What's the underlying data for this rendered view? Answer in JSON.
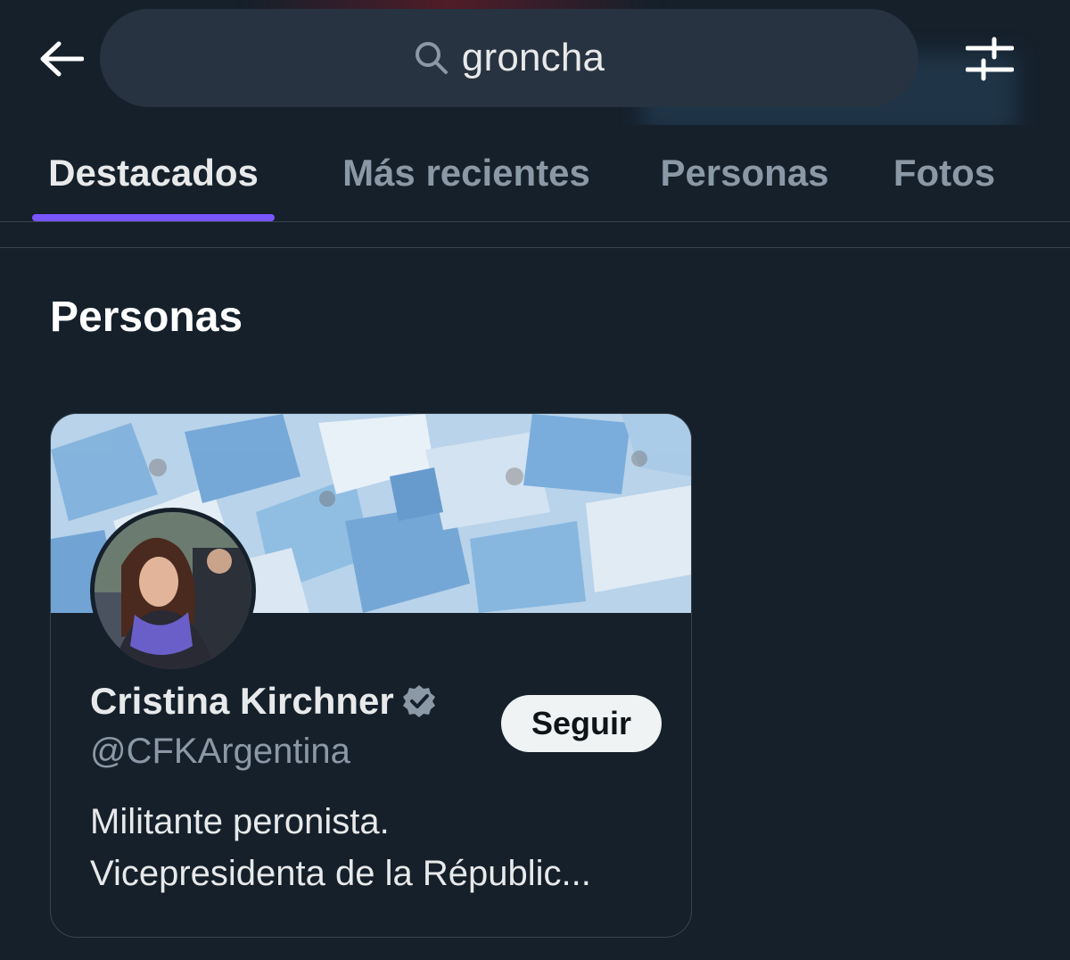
{
  "search": {
    "query": "groncha"
  },
  "icons": {
    "back": "arrow-left-icon",
    "search": "search-icon",
    "filter": "sliders-icon",
    "verified": "verified-badge-icon"
  },
  "tabs": [
    {
      "label": "Destacados",
      "active": true
    },
    {
      "label": "Más recientes",
      "active": false
    },
    {
      "label": "Personas",
      "active": false
    },
    {
      "label": "Fotos",
      "active": false
    }
  ],
  "section": {
    "title": "Personas"
  },
  "person_card": {
    "name": "Cristina Kirchner",
    "handle": "@CFKArgentina",
    "follow_label": "Seguir",
    "bio_lines": [
      "Militante peronista.",
      "Vicepresidenta de la Républic..."
    ]
  },
  "colors": {
    "background": "#15202b",
    "accent_indicator": "#7856ff",
    "secondary_text": "#8b98a5",
    "search_bg": "#273340"
  }
}
